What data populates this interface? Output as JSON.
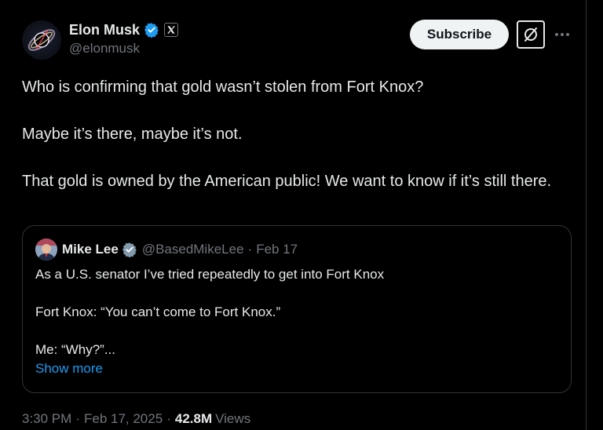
{
  "author": {
    "display_name": "Elon Musk",
    "handle": "@elonmusk",
    "verified": true,
    "affiliation_icon": "x-logo-icon"
  },
  "actions": {
    "subscribe_label": "Subscribe",
    "grok_icon": "grok-icon",
    "more_icon": "more-dots-icon"
  },
  "tweet": {
    "paragraphs": [
      "Who is confirming that gold wasn’t stolen from Fort Knox?",
      "Maybe it’s there, maybe it’s not.",
      "That gold is owned by the American public! We want to know if it’s still there."
    ]
  },
  "quote": {
    "display_name": "Mike Lee",
    "handle": "@BasedMikeLee",
    "separator": "·",
    "date": "Feb 17",
    "paragraphs": [
      "As a U.S. senator I’ve tried repeatedly to get into Fort Knox",
      "Fort Knox: “You can’t come to Fort Knox.”",
      "Me: “Why?”..."
    ],
    "show_more": "Show more"
  },
  "meta": {
    "time": "3:30 PM",
    "separator": "·",
    "date": "Feb 17, 2025",
    "views_count": "42.8M",
    "views_label": "Views"
  },
  "colors": {
    "background": "#000000",
    "text": "#e7e9ea",
    "muted": "#71767b",
    "accent": "#1d9bf0",
    "border": "#2f3336"
  }
}
